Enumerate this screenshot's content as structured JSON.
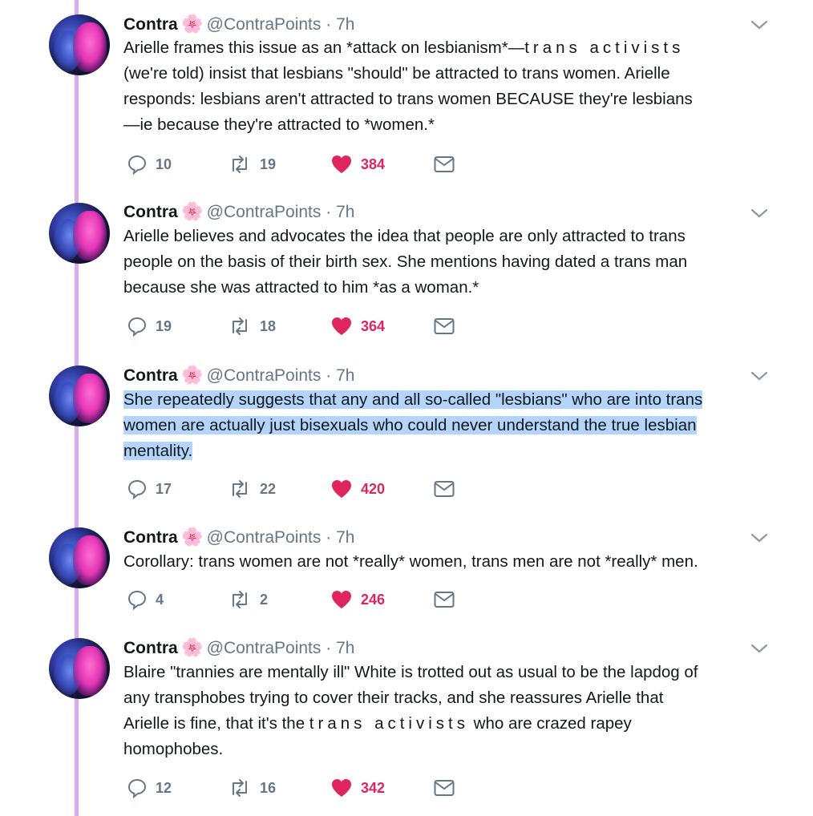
{
  "colors": {
    "thread_line": "#dbaaf0",
    "like": "#e0245e",
    "muted": "#657786",
    "highlight": "#b3d4fc"
  },
  "tweets": [
    {
      "name": "Contra",
      "emoji": "🌸",
      "handle": "@ContraPoints",
      "dot": "·",
      "time": "7h",
      "text_lines": [
        "Arielle frames this issue as an *attack on lesbianism*—",
        "trans activists",
        "(we're told) insist that lesbians \"should\" be attracted to trans women. Arielle",
        "responds: lesbians aren't attracted to trans women BECAUSE they're lesbians",
        "—ie because they're attracted to *women.*"
      ],
      "replies": "10",
      "retweets": "19",
      "likes": "384"
    },
    {
      "name": "Contra",
      "emoji": "🌸",
      "handle": "@ContraPoints",
      "dot": "·",
      "time": "7h",
      "text_lines": [
        "Arielle believes and advocates the idea that people are only attracted to trans",
        "people on the basis of their birth sex. She mentions having dated a trans man",
        "because she was attracted to him *as a woman.*"
      ],
      "replies": "19",
      "retweets": "18",
      "likes": "364"
    },
    {
      "name": "Contra",
      "emoji": "🌸",
      "handle": "@ContraPoints",
      "dot": "·",
      "time": "7h",
      "text_lines": [
        "She repeatedly suggests that any and all so-called \"lesbians\" who are into trans",
        "women are actually just bisexuals who could never understand the true lesbian",
        "mentality."
      ],
      "replies": "17",
      "retweets": "22",
      "likes": "420"
    },
    {
      "name": "Contra",
      "emoji": "🌸",
      "handle": "@ContraPoints",
      "dot": "·",
      "time": "7h",
      "text_lines": [
        "Corollary: trans women are not *really* women, trans men are not *really* men."
      ],
      "replies": "4",
      "retweets": "2",
      "likes": "246"
    },
    {
      "name": "Contra",
      "emoji": "🌸",
      "handle": "@ContraPoints",
      "dot": "·",
      "time": "7h",
      "text_lines": [
        "Blaire \"trannies are mentally ill\" White is trotted out as usual to be the lapdog of",
        "any transphobes trying to cover their tracks, and she reassures Arielle that",
        "Arielle is fine, that it's the ",
        "trans activists",
        " who are crazed rapey",
        "homophobes."
      ],
      "replies": "12",
      "retweets": "16",
      "likes": "342"
    }
  ]
}
